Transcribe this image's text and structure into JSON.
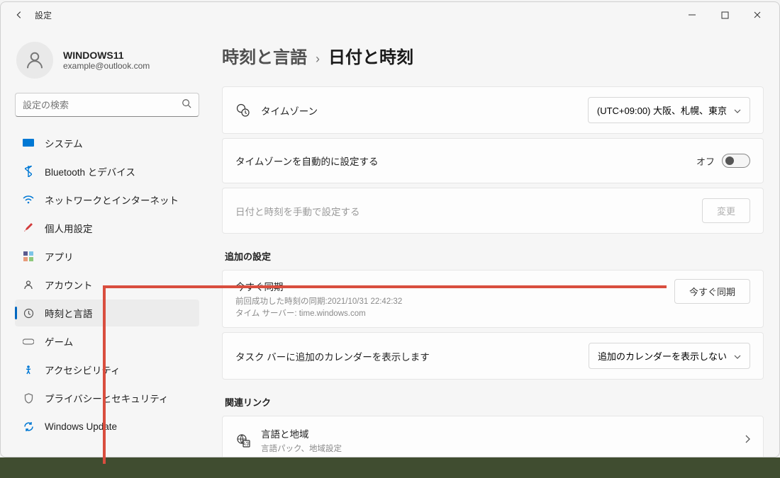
{
  "titlebar": {
    "title": "設定"
  },
  "user": {
    "name": "WINDOWS11",
    "email": "example@outlook.com"
  },
  "search": {
    "placeholder": "設定の検索"
  },
  "nav": {
    "items": [
      {
        "label": "システム",
        "icon_color": "#0078d4"
      },
      {
        "label": "Bluetooth とデバイス",
        "icon_color": "#0078d4"
      },
      {
        "label": "ネットワークとインターネット",
        "icon_color": "#0078d4"
      },
      {
        "label": "個人用設定",
        "icon_color": "#d23a3a"
      },
      {
        "label": "アプリ",
        "icon_color": "#5b5b8f"
      },
      {
        "label": "アカウント",
        "icon_color": "#6e6e6e"
      },
      {
        "label": "時刻と言語",
        "icon_color": "#6e6e6e",
        "selected": true
      },
      {
        "label": "ゲーム",
        "icon_color": "#6e6e6e"
      },
      {
        "label": "アクセシビリティ",
        "icon_color": "#0078d4"
      },
      {
        "label": "プライバシーとセキュリティ",
        "icon_color": "#6e6e6e"
      },
      {
        "label": "Windows Update",
        "icon_color": "#0078d4"
      }
    ]
  },
  "breadcrumb": {
    "parent": "時刻と言語",
    "current": "日付と時刻"
  },
  "timezone": {
    "label": "タイムゾーン",
    "value": "(UTC+09:00) 大阪、札幌、東京"
  },
  "auto_timezone": {
    "label": "タイムゾーンを自動的に設定する",
    "state": "オフ"
  },
  "manual_datetime": {
    "label": "日付と時刻を手動で設定する",
    "button": "変更"
  },
  "sections": {
    "additional": "追加の設定",
    "related": "関連リンク"
  },
  "sync": {
    "title": "今すぐ同期",
    "last": "前回成功した時刻の同期:2021/10/31 22:42:32",
    "server": "タイム サーバー: time.windows.com",
    "button": "今すぐ同期"
  },
  "calendar": {
    "label": "タスク バーに追加のカレンダーを表示します",
    "value": "追加のカレンダーを表示しない"
  },
  "lang_link": {
    "title": "言語と地域",
    "sub": "言語パック、地域設定"
  }
}
